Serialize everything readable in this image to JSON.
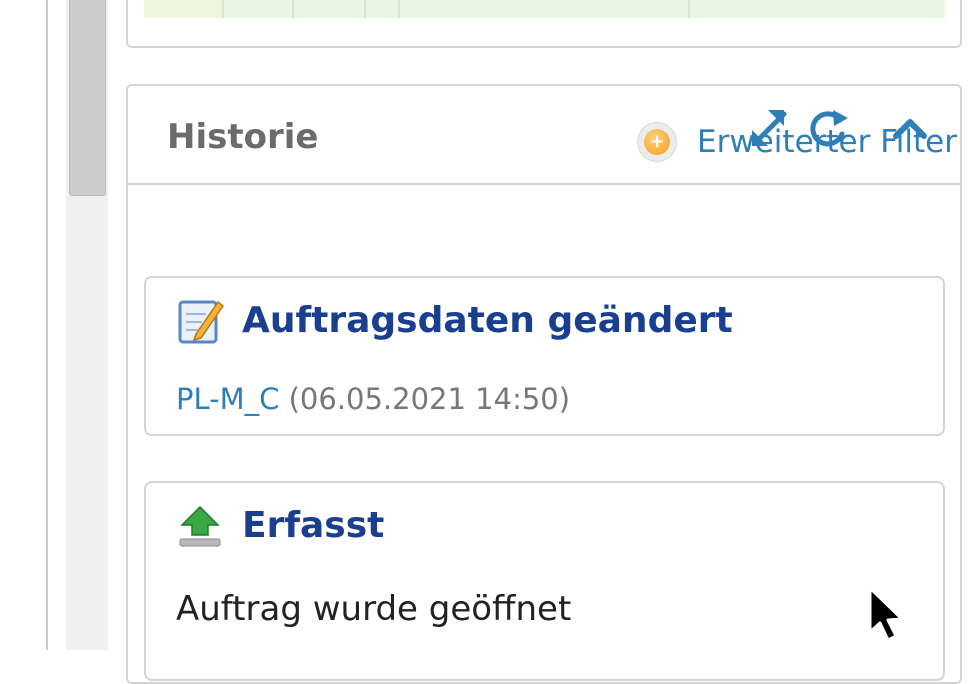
{
  "panel": {
    "title": "Historie",
    "header_icons": [
      "expand-icon",
      "refresh-icon",
      "collapse-chevron-up-icon"
    ]
  },
  "filter": {
    "label": "Erweiterter Filter",
    "icon": "plus-circle-icon"
  },
  "history": [
    {
      "title": "Auftragsdaten geändert",
      "icon": "edit-document-icon",
      "user": "PL-M_C",
      "timestamp": "(06.05.2021 14:50)"
    },
    {
      "title": "Erfasst",
      "icon": "upload-arrow-icon",
      "description": "Auftrag wurde geöffnet"
    }
  ],
  "colors": {
    "accent_blue": "#2e7fb8",
    "title_navy": "#1a3f8f",
    "header_gray": "#6b6b6b",
    "row_green": "#e9f6e3",
    "border": "#d4d4d4"
  }
}
